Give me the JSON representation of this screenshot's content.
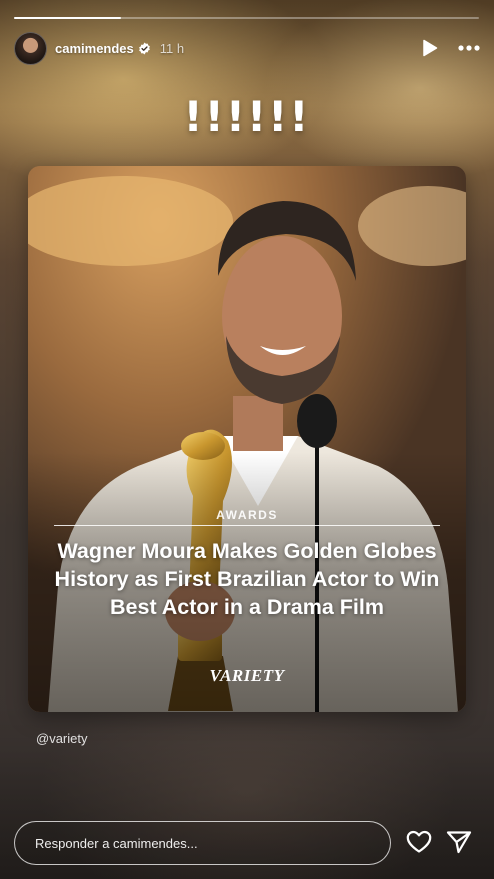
{
  "story": {
    "progress": 0.23,
    "author": {
      "username": "camimendes",
      "verified": true,
      "time_ago": "11 h",
      "avatar_icon": "profile-avatar"
    },
    "actions": {
      "play_icon": "play-icon",
      "more_icon": "more-options-icon"
    },
    "caption": "!!!!!!",
    "post": {
      "category": "AWARDS",
      "headline": "Wagner Moura Makes Golden Globes History as First Brazilian Actor to Win Best Actor in a Drama Film",
      "brand": "VARIETY"
    },
    "mention": "@variety",
    "footer": {
      "reply_placeholder": "Responder a camimendes...",
      "like_icon": "heart-icon",
      "share_icon": "send-icon"
    }
  },
  "colors": {
    "text": "#ffffff",
    "verified_badge": "#ffffff"
  }
}
